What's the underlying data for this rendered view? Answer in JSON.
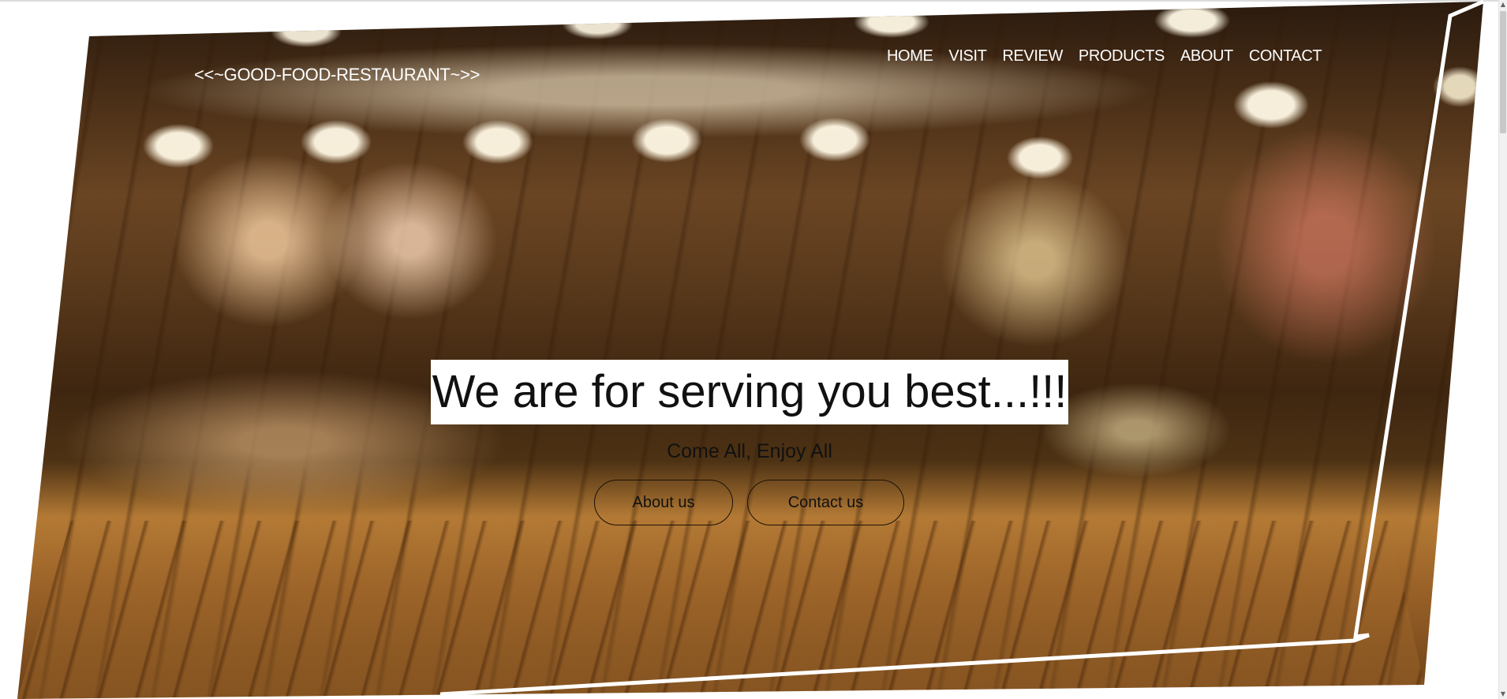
{
  "header": {
    "brand": "<<~GOOD-FOOD-RESTAURANT~>>",
    "nav": [
      {
        "label": "HOME"
      },
      {
        "label": "VISIT"
      },
      {
        "label": "REVIEW"
      },
      {
        "label": "PRODUCTS"
      },
      {
        "label": "ABOUT"
      },
      {
        "label": "CONTACT"
      }
    ]
  },
  "hero": {
    "headline": "We are for serving you best...!!!",
    "subline": "Come All, Enjoy All",
    "buttons": {
      "about_label": "About us",
      "contact_label": "Contact us"
    },
    "background": "blurred-restaurant-interior-with-wooden-table-photo"
  },
  "colors": {
    "nav_text": "#ffffff",
    "headline_bg": "#ffffff",
    "headline_text": "#111111",
    "button_border": "#1b1208",
    "page_bg": "#ffffff"
  }
}
